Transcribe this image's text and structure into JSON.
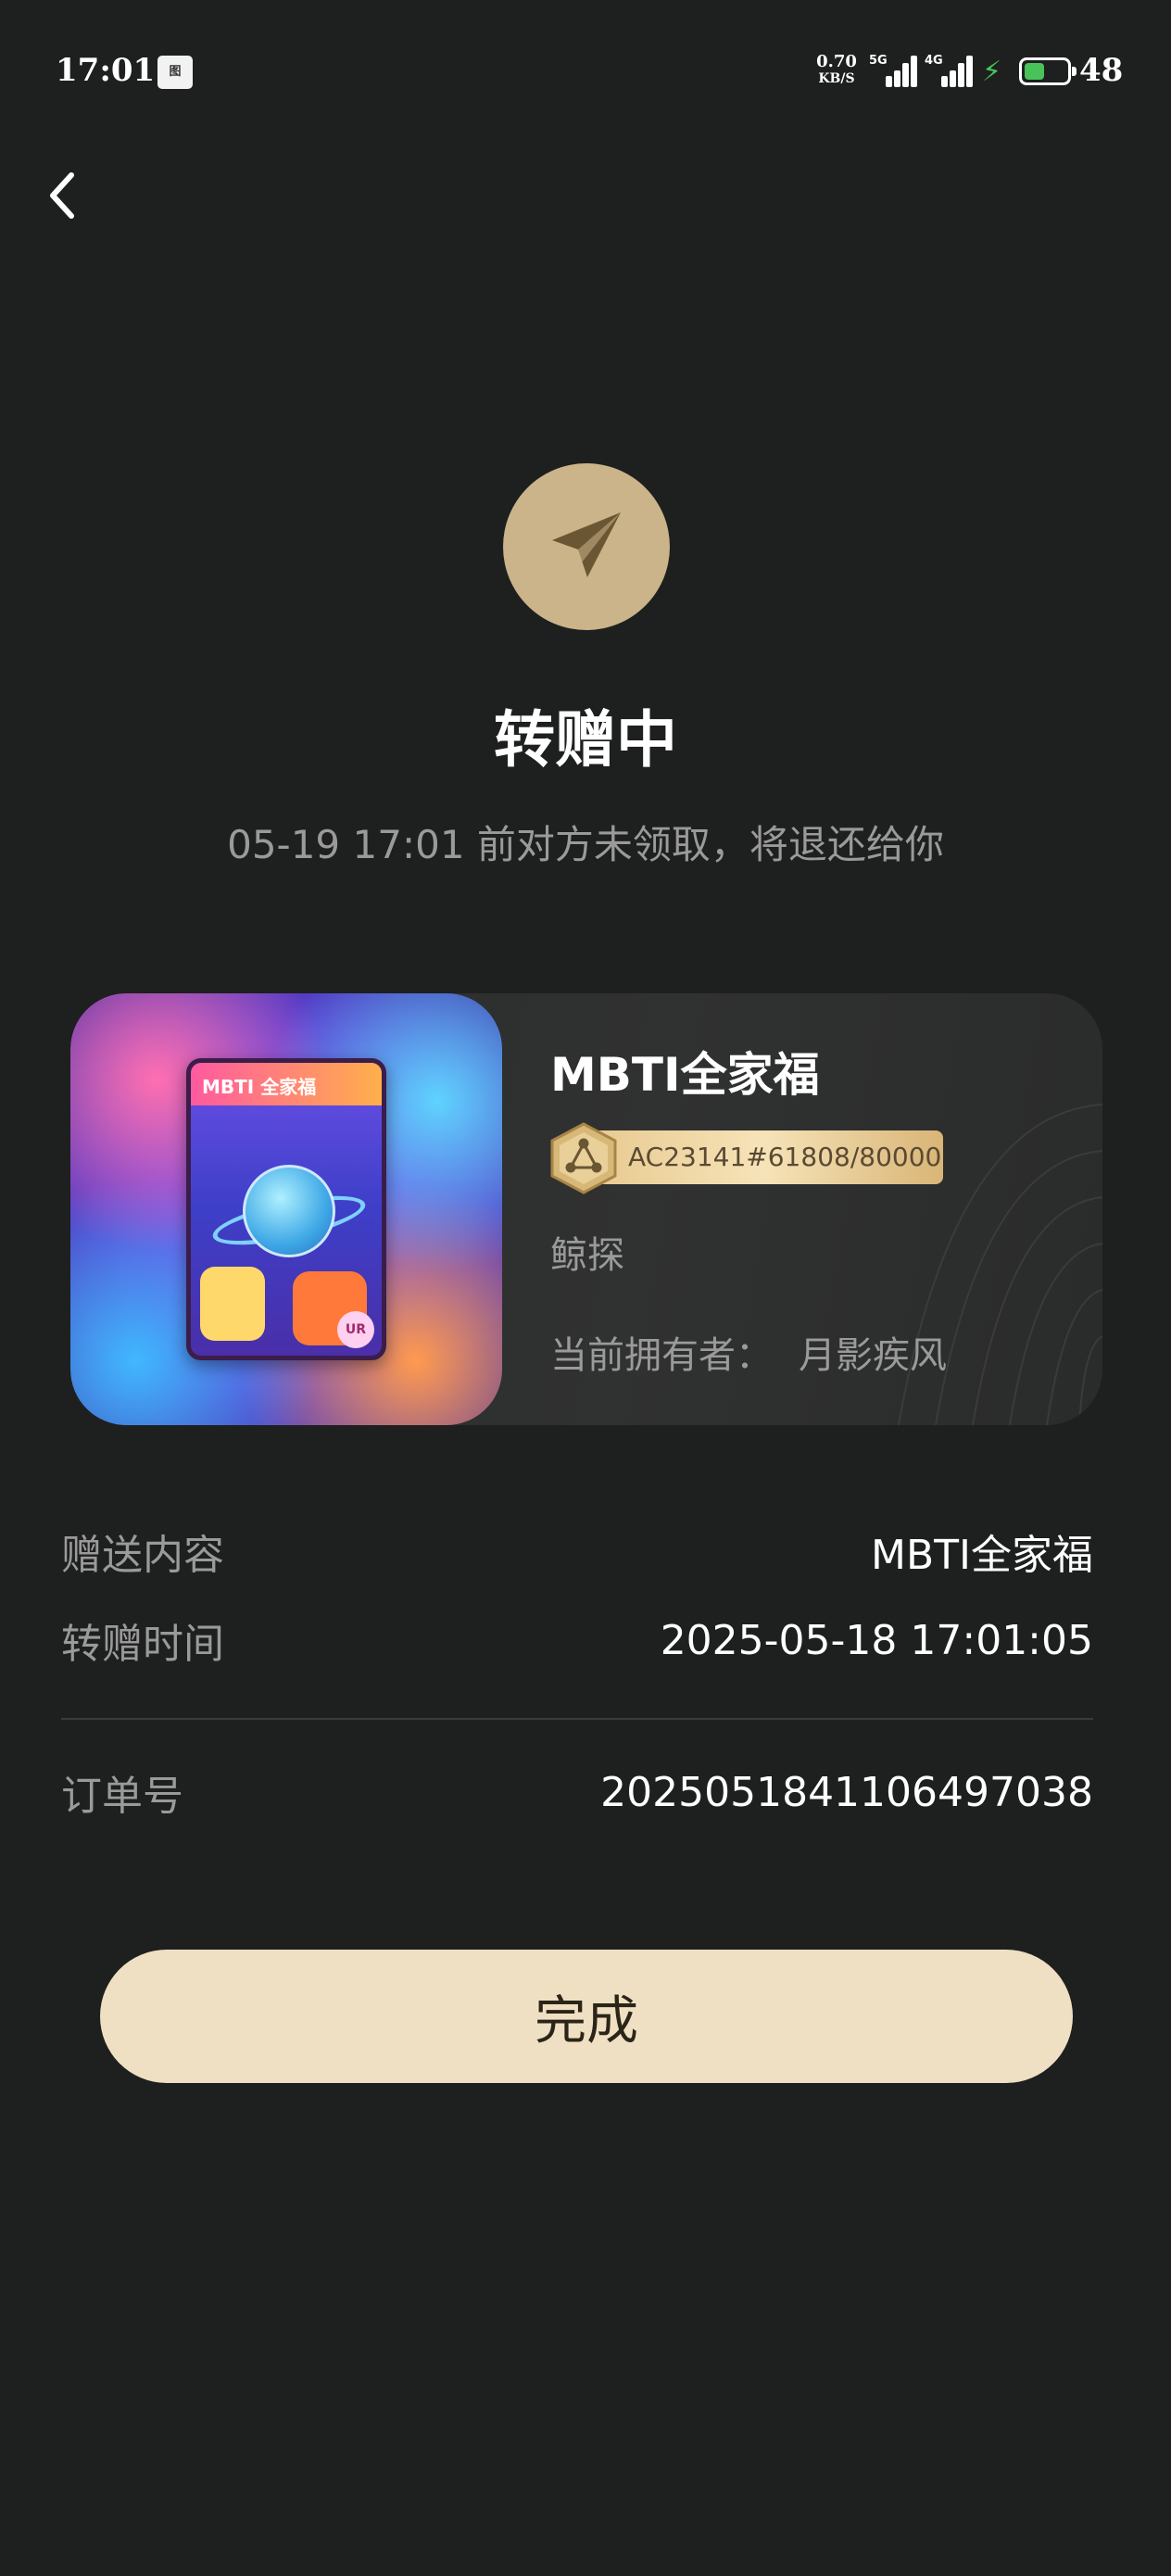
{
  "status_bar": {
    "time": "17:01",
    "app_icon_label": "图",
    "net_speed_value": "0.70",
    "net_speed_unit": "KB/S",
    "signal_1_label": "5G",
    "signal_2_label": "4G",
    "battery_level": "48",
    "battery_fill_fraction": 0.48,
    "charging_color": "#49c25a"
  },
  "header": {
    "back_icon": "chevron-left-icon",
    "status_icon": "paper-plane-icon",
    "title": "转赠中",
    "subtitle": "05-19 17:01 前对方未领取，将退还给你"
  },
  "card": {
    "item_name": "MBTI全家福",
    "mini_card_title": "MBTI 全家福",
    "mini_card_badge": "UR",
    "serial": "AC23141#61808/80000",
    "creator": "鲸探",
    "owner_label": "当前拥有者：",
    "owner_name": "月影疾风"
  },
  "details": {
    "gift_content_label": "赠送内容",
    "gift_content_value": "MBTI全家福",
    "transfer_time_label": "转赠时间",
    "transfer_time_value": "2025-05-18 17:01:05",
    "order_no_label": "订单号",
    "order_no_value": "2025051841106497038"
  },
  "actions": {
    "done_label": "完成"
  },
  "colors": {
    "background": "#1e1f1f",
    "accent_gold": "#cbb489",
    "button_bg": "#efe0c3",
    "muted_text": "#9a9a9a"
  }
}
